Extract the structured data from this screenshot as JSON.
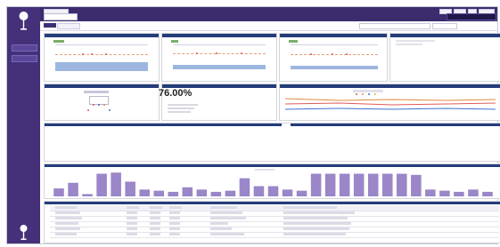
{
  "app": {
    "title": ""
  },
  "sidebar": {
    "items": [
      {
        "label": ""
      },
      {
        "label": ""
      }
    ]
  },
  "top_panels": [
    {
      "title": "",
      "stat_a": "",
      "stat_b": ""
    },
    {
      "title": "",
      "stat_a": "",
      "stat_b": ""
    },
    {
      "title": "",
      "stat_a": "",
      "stat_b": ""
    },
    {
      "title": "",
      "stat_a": "",
      "stat_b": ""
    }
  ],
  "mid_panels": [
    {
      "title": ""
    },
    {
      "title": ""
    },
    {
      "title": ""
    }
  ],
  "kpi": {
    "value": "76.00%"
  },
  "timeline_panel": {
    "title": ""
  },
  "histogram_panel": {
    "title": "",
    "chart_data": {
      "type": "bar",
      "values": [
        7,
        12,
        2,
        20,
        21,
        13,
        6,
        5,
        4,
        8,
        6,
        4,
        5,
        16,
        9,
        9,
        6,
        5,
        20,
        20,
        20,
        20,
        20,
        20,
        20,
        19,
        6,
        5,
        4,
        6,
        4
      ]
    }
  },
  "table": {
    "headers": [
      "",
      "",
      "",
      "",
      "",
      ""
    ],
    "rows": [
      [
        "",
        "",
        "",
        "",
        "",
        ""
      ],
      [
        "",
        "",
        "",
        "",
        "",
        ""
      ],
      [
        "",
        "",
        "",
        "",
        "",
        ""
      ],
      [
        "",
        "",
        "",
        "",
        "",
        ""
      ],
      [
        "",
        "",
        "",
        "",
        "",
        ""
      ]
    ]
  }
}
